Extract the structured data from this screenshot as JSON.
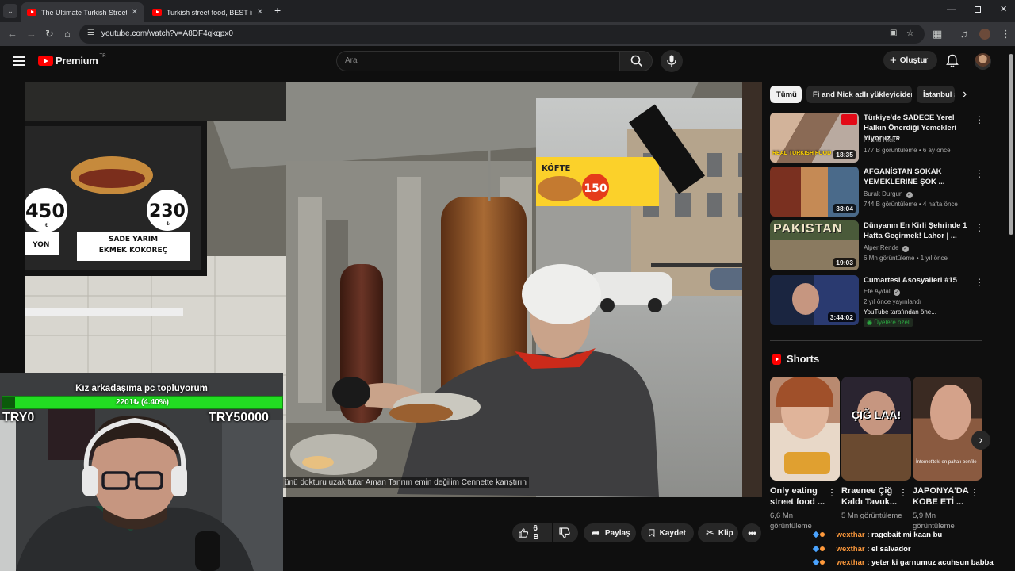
{
  "browser": {
    "tabs": [
      {
        "title": "The Ultimate Turkish Street Food",
        "active": true
      },
      {
        "title": "Turkish street food, BEST in the",
        "active": false
      }
    ],
    "url": "youtube.com/watch?v=A8DF4qkqpx0"
  },
  "header": {
    "logo_text": "Premium",
    "region": "TR",
    "search_placeholder": "Ara",
    "create_label": "Oluştur"
  },
  "video": {
    "caption": "ünü dokturu uzak tutar Aman Tanrım emin değilim Cennette karıştırın",
    "sign_prices": [
      "450",
      "230"
    ],
    "sign_currency": "₺",
    "sign_left_label": "YON",
    "sign_right_label": "SADE YARIM EKMEK KOKOREÇ",
    "shop_sign": "KÖFTE",
    "shop_price": "150"
  },
  "overlay": {
    "goal_title": "Kız arkadaşıma pc topluyorum",
    "goal_progress_text": "2201₺ (4.40%)",
    "goal_progress": 0.044,
    "goal_min": "TRY0",
    "goal_max": "TRY50000"
  },
  "actions": {
    "like_count": "6 B",
    "share": "Paylaş",
    "save": "Kaydet",
    "clip": "Klip"
  },
  "chips": [
    {
      "label": "Tümü",
      "active": true
    },
    {
      "label": "Fi and Nick adlı yükleyiciden",
      "active": false
    },
    {
      "label": "İstanbul s",
      "active": false
    }
  ],
  "recommendations": [
    {
      "title": "Türkiye'de SADECE Yerel Halkın Önerdiği Yemekleri Yiyoruz",
      "title_suffix": "TR",
      "channel": "Fi and Nick",
      "meta": "177 B görüntüleme • 6 ay önce",
      "duration": "18:35",
      "thumb_text": "REAL TURKISH FOOD"
    },
    {
      "title": "AFGANİSTAN SOKAK YEMEKLERİNE ŞOK ...",
      "channel": "Burak Durgun",
      "meta": "744 B görüntüleme • 4 hafta önce",
      "duration": "38:04",
      "verified": true
    },
    {
      "title": "Dünyanın En Kirli Şehrinde 1 Hafta Geçirmek! Lahor | ...",
      "channel": "Alper Rende",
      "meta": "6 Mn görüntüleme • 1 yıl önce",
      "duration": "19:03",
      "verified": true,
      "thumb_text": "PAKISTAN"
    },
    {
      "title": "Cumartesi Asosyalleri #15",
      "channel": "Efe Aydal",
      "meta": "2 yıl önce yayınlandı",
      "extra": "YouTube tarafından öne...",
      "badge": "Üyelere özel",
      "duration": "3:44:02",
      "verified": true
    }
  ],
  "shorts": {
    "heading": "Shorts",
    "items": [
      {
        "title": "Only eating street food ...",
        "views": "6,6 Mn görüntüleme"
      },
      {
        "title": "Rraenee Çiğ Kaldı Tavuk...",
        "views": "5 Mn görüntüleme",
        "thumb_text": "ÇIĞ LAA!"
      },
      {
        "title": "JAPONYA'DA KOBE ETİ ...",
        "views": "5,9 Mn görüntüleme",
        "thumb_text": "İnternet'teki en pahalı bonfile"
      }
    ]
  },
  "chat": [
    {
      "user": "wexthar",
      "message": ": ragebait mi kaan bu"
    },
    {
      "user": "wexthar",
      "message": ": el salvador"
    },
    {
      "user": "wexthar",
      "message": ": yeter ki garnumuz acuhsun babba"
    }
  ],
  "colors": {
    "brand_red": "#ff0000",
    "goal_green": "#22dd22",
    "chat_user": "#ff9a3c",
    "member_green": "#2ba640"
  }
}
